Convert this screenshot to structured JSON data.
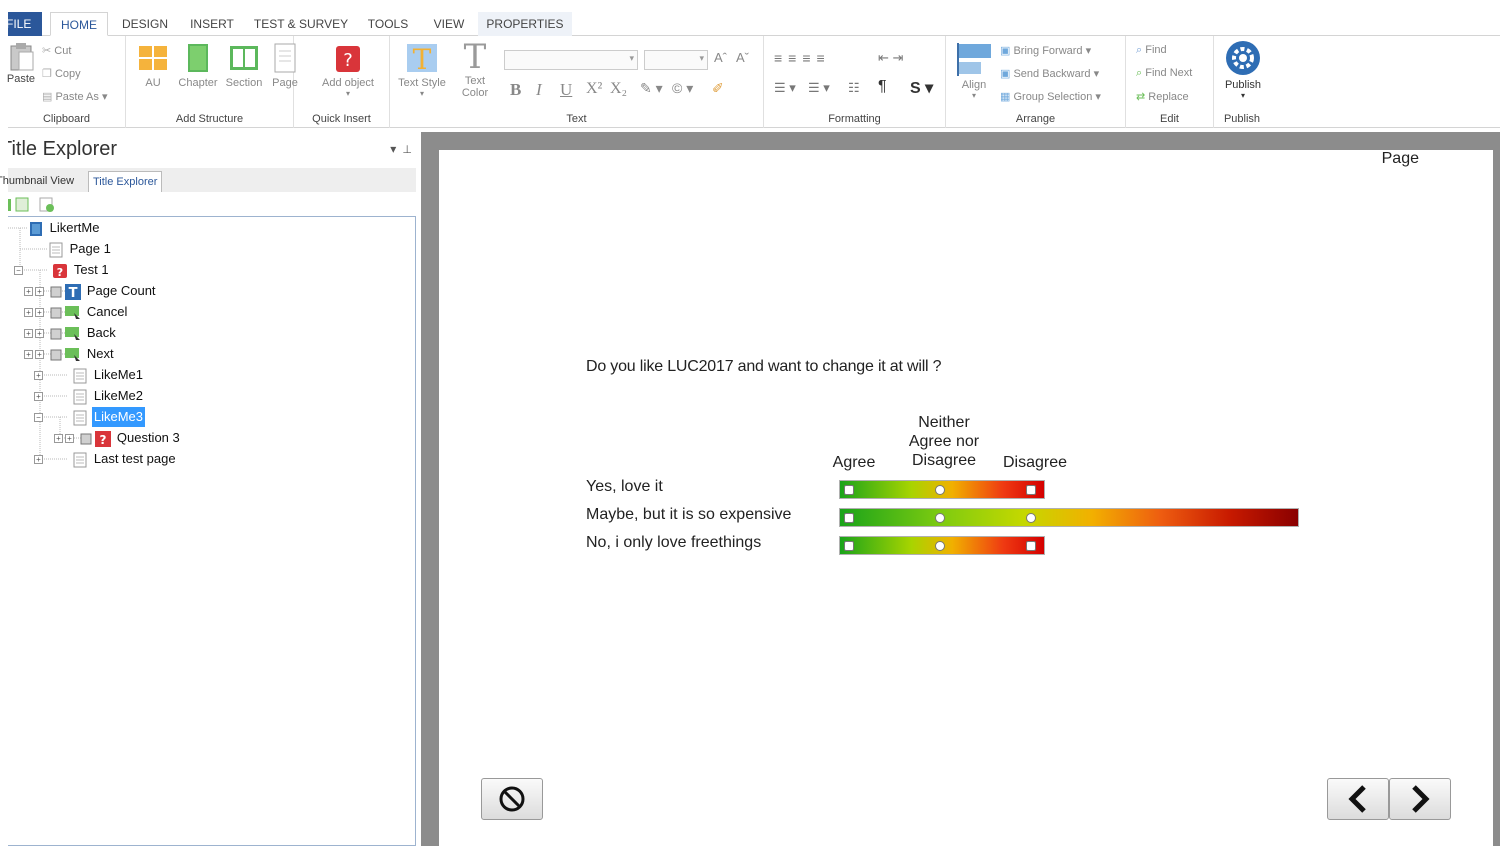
{
  "tabs": [
    {
      "label": "FILE"
    },
    {
      "label": "HOME"
    },
    {
      "label": "DESIGN"
    },
    {
      "label": "INSERT"
    },
    {
      "label": "TEST & SURVEY"
    },
    {
      "label": "TOOLS"
    },
    {
      "label": "VIEW"
    },
    {
      "label": "PROPERTIES"
    }
  ],
  "ribbon": {
    "clipboard": {
      "paste": "Paste",
      "cut": "Cut",
      "copy": "Copy",
      "paste_as": "Paste As",
      "label": "Clipboard"
    },
    "structure": {
      "au": "AU",
      "chapter": "Chapter",
      "section": "Section",
      "page": "Page",
      "label": "Add Structure"
    },
    "quick": {
      "add_object": "Add object",
      "label": "Quick Insert"
    },
    "text": {
      "text_style": "Text Style",
      "text_color": "Text Color",
      "label": "Text"
    },
    "formatting": {
      "label": "Formatting"
    },
    "arrange": {
      "align": "Align",
      "bring_forward": "Bring Forward",
      "send_backward": "Send Backward",
      "group_selection": "Group Selection",
      "label": "Arrange"
    },
    "edit": {
      "find": "Find",
      "find_next": "Find Next",
      "replace": "Replace",
      "label": "Edit"
    },
    "publish": {
      "publish": "Publish",
      "label": "Publish"
    }
  },
  "explorer": {
    "title": "Title Explorer",
    "tabs": [
      "Thumbnail View",
      "Title Explorer"
    ],
    "tree": [
      {
        "label": "LikertMe"
      },
      {
        "label": "Page 1"
      },
      {
        "label": "Test 1"
      },
      {
        "label": "Page Count"
      },
      {
        "label": "Cancel"
      },
      {
        "label": "Back"
      },
      {
        "label": "Next"
      },
      {
        "label": "LikeMe1"
      },
      {
        "label": "LikeMe2"
      },
      {
        "label": "LikeMe3"
      },
      {
        "label": "Question 3"
      },
      {
        "label": "Last test page"
      }
    ]
  },
  "stage": {
    "page_label": "Page",
    "question": "Do you like LUC2017 and want to change it at will ?",
    "columns": [
      "Agree",
      "Neither Agree nor Disagree",
      "Disagree"
    ],
    "column_lines": [
      "Neither",
      "Agree nor",
      "Disagree"
    ],
    "rows": [
      {
        "label": "Yes, love it"
      },
      {
        "label": "Maybe, but it is so expensive"
      },
      {
        "label": "No, i only love freethings"
      }
    ]
  },
  "colors": {
    "accent": "#2b579a",
    "selection": "#3399ff",
    "stage_bg": "#8c8c8c"
  }
}
